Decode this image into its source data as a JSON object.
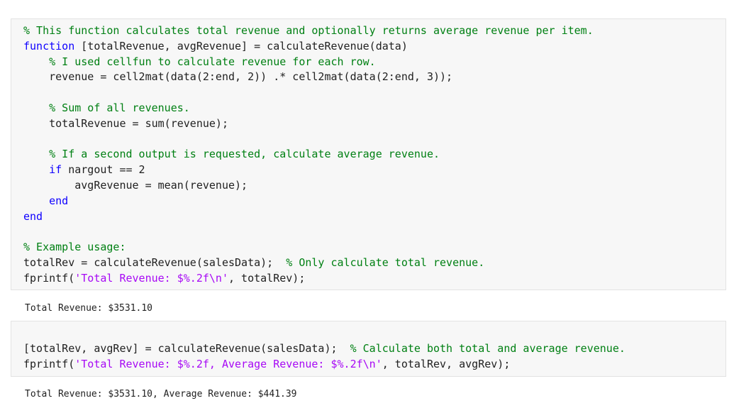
{
  "colors": {
    "comment": "#008013",
    "keyword": "#0e00ff",
    "string": "#a709f5",
    "text": "#212121",
    "cell_background": "#f7f7f7"
  },
  "cells": [
    {
      "lines": [
        [
          {
            "t": "comment",
            "s": "% This function calculates total revenue and optionally returns average revenue per item."
          }
        ],
        [
          {
            "t": "keyword",
            "s": "function"
          },
          {
            "t": "plain",
            "s": " [totalRevenue, avgRevenue] = calculateRevenue(data)"
          }
        ],
        [
          {
            "t": "plain",
            "s": "    "
          },
          {
            "t": "comment",
            "s": "% I used cellfun to calculate revenue for each row."
          }
        ],
        [
          {
            "t": "plain",
            "s": "    revenue = cell2mat(data(2:end, 2)) .* cell2mat(data(2:end, 3));"
          }
        ],
        [],
        [
          {
            "t": "plain",
            "s": "    "
          },
          {
            "t": "comment",
            "s": "% Sum of all revenues."
          }
        ],
        [
          {
            "t": "plain",
            "s": "    totalRevenue = sum(revenue);"
          }
        ],
        [],
        [
          {
            "t": "plain",
            "s": "    "
          },
          {
            "t": "comment",
            "s": "% If a second output is requested, calculate average revenue."
          }
        ],
        [
          {
            "t": "plain",
            "s": "    "
          },
          {
            "t": "keyword",
            "s": "if"
          },
          {
            "t": "plain",
            "s": " nargout == 2"
          }
        ],
        [
          {
            "t": "plain",
            "s": "        avgRevenue = mean(revenue);"
          }
        ],
        [
          {
            "t": "plain",
            "s": "    "
          },
          {
            "t": "keyword",
            "s": "end"
          }
        ],
        [
          {
            "t": "keyword",
            "s": "end"
          }
        ],
        [],
        [
          {
            "t": "comment",
            "s": "% Example usage:"
          }
        ],
        [
          {
            "t": "plain",
            "s": "totalRev = calculateRevenue(salesData);  "
          },
          {
            "t": "comment",
            "s": "% Only calculate total revenue."
          }
        ],
        [
          {
            "t": "plain",
            "s": "fprintf("
          },
          {
            "t": "string",
            "s": "'Total Revenue: $%.2f\\n'"
          },
          {
            "t": "plain",
            "s": ", totalRev);"
          }
        ]
      ],
      "output": "Total Revenue: $3531.10"
    },
    {
      "lines": [
        [
          {
            "t": "plain",
            "s": "[totalRev, avgRev] = calculateRevenue(salesData);  "
          },
          {
            "t": "comment",
            "s": "% Calculate both total and average revenue."
          }
        ],
        [
          {
            "t": "plain",
            "s": "fprintf("
          },
          {
            "t": "string",
            "s": "'Total Revenue: $%.2f, Average Revenue: $%.2f\\n'"
          },
          {
            "t": "plain",
            "s": ", totalRev, avgRev);"
          }
        ]
      ],
      "output": "Total Revenue: $3531.10, Average Revenue: $441.39"
    }
  ]
}
